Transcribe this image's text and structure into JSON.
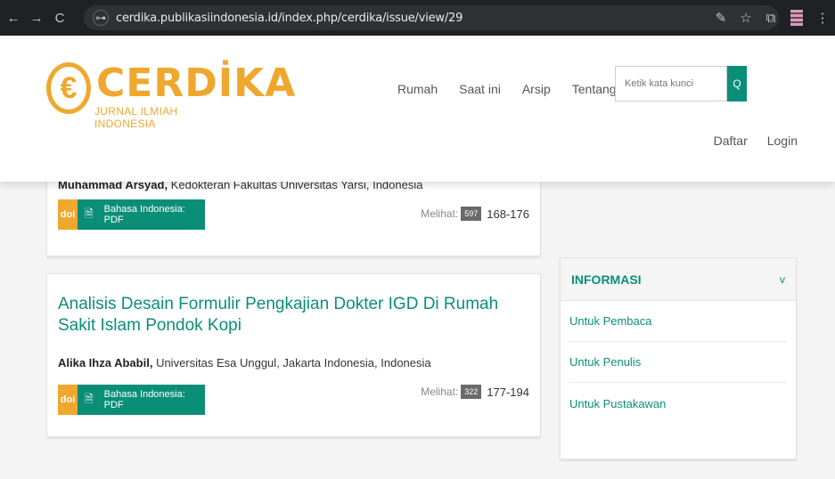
{
  "browser": {
    "url": "cerdika.publikasiindonesia.id/index.php/cerdika/issue/view/29",
    "back_glyph": "←",
    "forward_glyph": "→",
    "reload_glyph": "C",
    "site_info_glyph": "⊶",
    "translate_glyph": "✎",
    "bookmark_glyph": "☆",
    "extensions_glyph": "⧉",
    "menu_glyph": "⋮"
  },
  "header": {
    "logo_letter": "€",
    "logo_name": "CERDİKA",
    "logo_subtitle": "JURNAL ILMIAH INDONESIA",
    "menu": [
      "Rumah",
      "Saat ini",
      "Arsip",
      "Tentang ▾"
    ],
    "search_placeholder": "Ketik kata kunci",
    "search_glyph": "Q",
    "register_label": "Daftar",
    "login_label": "Login"
  },
  "articles": [
    {
      "author_name": "Muhammad Arsyad,",
      "affiliation": "Kedokteran Fakultas Universitas Yarsi, Indonesia",
      "doi_label": "doi",
      "galley_label": "Bahasa Indonesia: PDF",
      "views_label": "Melihat:",
      "views": "597",
      "pages": "168-176"
    },
    {
      "title": "Analisis Desain Formulir Pengkajian Dokter IGD Di Rumah Sakit Islam Pondok Kopi",
      "author_name": "Alika Ihza Ababil,",
      "affiliation": "Universitas Esa Unggul, Jakarta Indonesia, Indonesia",
      "doi_label": "doi",
      "galley_label": "Bahasa Indonesia: PDF",
      "views_label": "Melihat:",
      "views": "322",
      "pages": "177-194"
    }
  ],
  "sidebar": {
    "title": "INFORMASI",
    "chevron": "v",
    "links": [
      "Untuk Pembaca",
      "Untuk Penulis",
      "Untuk Pustakawan"
    ]
  },
  "colors": {
    "accent": "#0b8e78",
    "brand": "#f0a72e"
  }
}
